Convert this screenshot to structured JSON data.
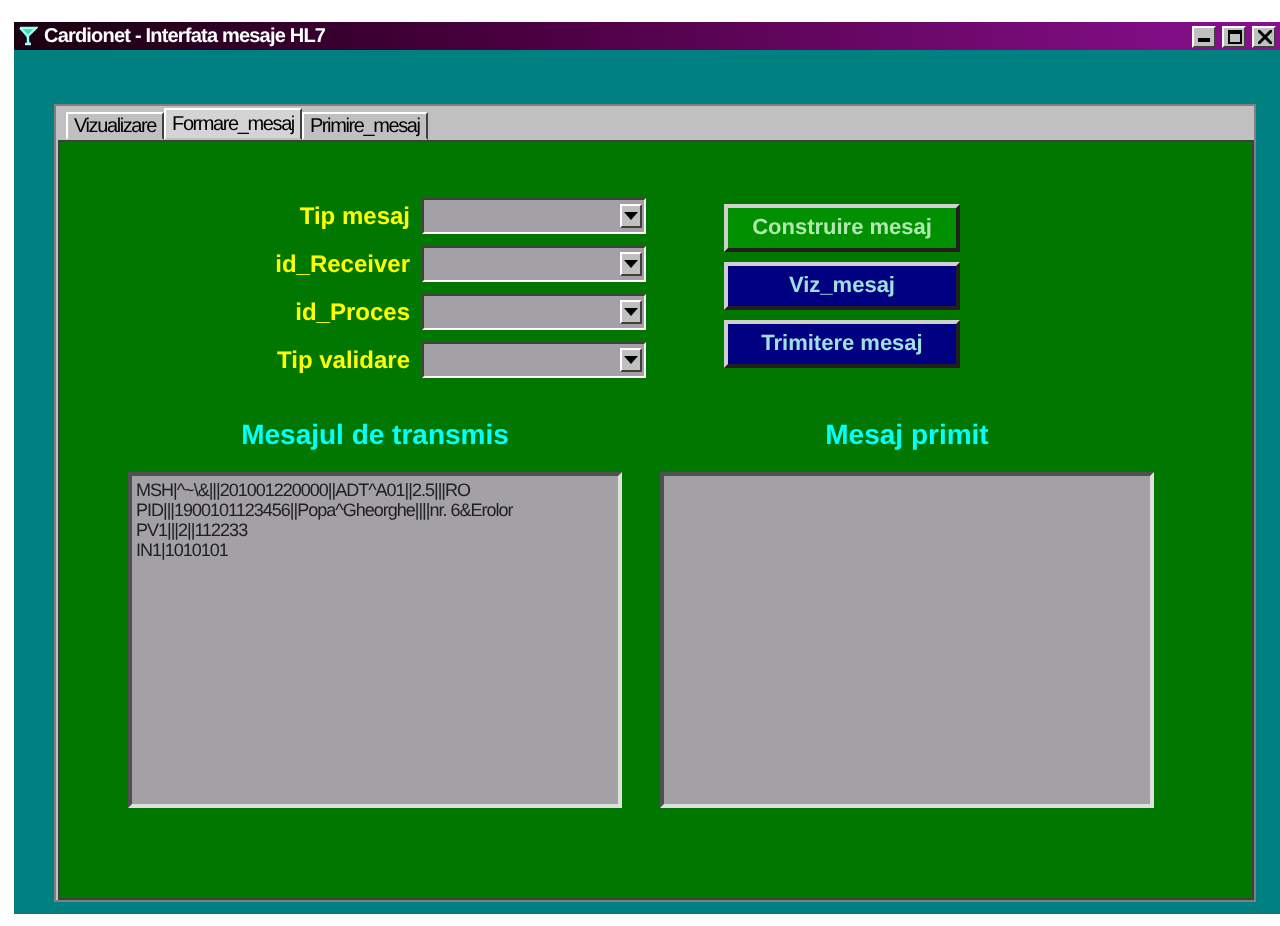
{
  "window": {
    "title": "Cardionet - Interfata mesaje HL7"
  },
  "tabs": [
    {
      "label": "Vizualizare",
      "selected": false
    },
    {
      "label": "Formare_mesaj",
      "selected": true
    },
    {
      "label": "Primire_mesaj",
      "selected": false
    }
  ],
  "fields": [
    {
      "label": "Tip mesaj"
    },
    {
      "label": "id_Receiver"
    },
    {
      "label": "id_Proces"
    },
    {
      "label": "Tip validare"
    }
  ],
  "buttons": [
    {
      "label": "Construire mesaj",
      "kind": "green"
    },
    {
      "label": "Viz_mesaj",
      "kind": "blue"
    },
    {
      "label": "Trimitere mesaj",
      "kind": "blue"
    }
  ],
  "outgoing": {
    "heading": "Mesajul de transmis",
    "lines": [
      "MSH|^~\\&|||201001220000||ADT^A01||2.5|||RO",
      "PID|||1900101123456||Popa^Gheorghe||||nr. 6&Erolor",
      "PV1|||2||112233",
      "IN1|1010101"
    ]
  },
  "incoming": {
    "heading": "Mesaj primit"
  }
}
